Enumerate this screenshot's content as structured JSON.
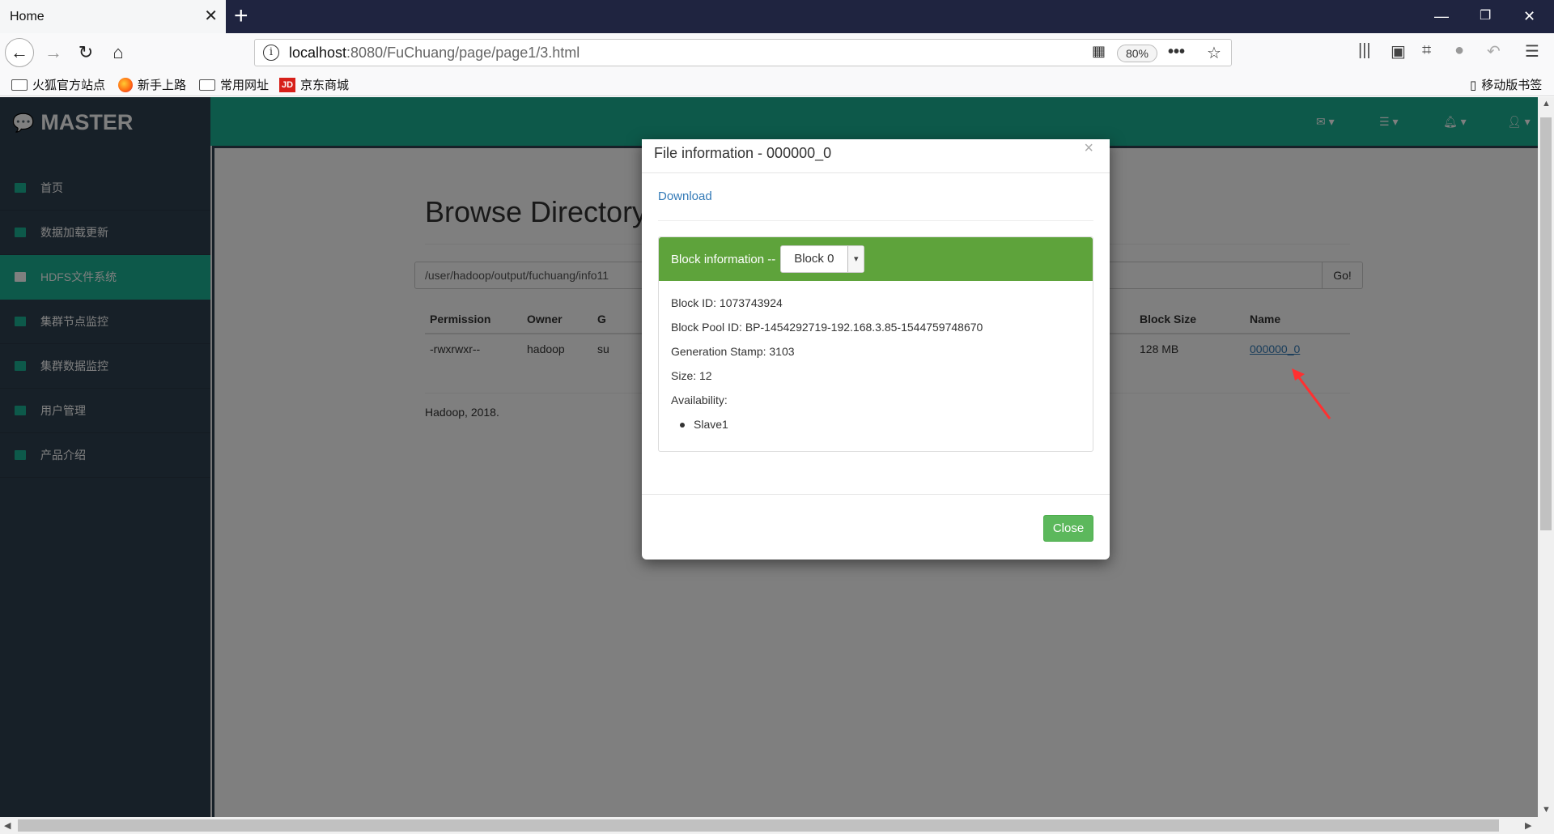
{
  "browser": {
    "tab_title": "Home",
    "url_host": "localhost",
    "url_rest": ":8080/FuChuang/page/page1/3.html",
    "zoom": "80%",
    "bookmarks": [
      "火狐官方站点",
      "新手上路",
      "常用网址",
      "京东商城"
    ],
    "mobile_bookmarks": "移动版书签",
    "jd_logo_text": "JD"
  },
  "app": {
    "logo": "MASTER",
    "menu": [
      {
        "label": "首页",
        "icon": "dashboard-icon",
        "active": false
      },
      {
        "label": "数据加载更新",
        "icon": "monitor-icon",
        "active": false
      },
      {
        "label": "HDFS文件系统",
        "icon": "bar-chart-icon",
        "active": true
      },
      {
        "label": "集群节点监控",
        "icon": "bar-chart-icon",
        "active": false
      },
      {
        "label": "集群数据监控",
        "icon": "file-icon",
        "active": false
      },
      {
        "label": "用户管理",
        "icon": "table-icon",
        "active": false
      },
      {
        "label": "产品介绍",
        "icon": "list-icon",
        "active": false
      }
    ],
    "accent_color": "#1ab394",
    "sidebar_color": "#2f4050"
  },
  "browse": {
    "heading": "Browse Directory",
    "path": "/user/hadoop/output/fuchuang/info11",
    "go_label": "Go!",
    "columns": [
      "Permission",
      "Owner",
      "G",
      "Block Size",
      "Name"
    ],
    "row": {
      "permission": "-rwxrwxr--",
      "owner": "hadoop",
      "group_fragment": "su",
      "block_size": "128 MB",
      "name": "000000_0"
    },
    "footer": "Hadoop, 2018."
  },
  "modal": {
    "title": "File information - 000000_0",
    "close_x": "×",
    "download": "Download",
    "block_info_label": "Block information --",
    "block_select": "Block 0",
    "block_id": "Block ID: 1073743924",
    "block_pool_id": "Block Pool ID: BP-1454292719-192.168.3.85-1544759748670",
    "generation_stamp": "Generation Stamp: 3103",
    "size": "Size: 12",
    "availability": "Availability:",
    "nodes": [
      "Slave1"
    ],
    "close_button": "Close"
  }
}
